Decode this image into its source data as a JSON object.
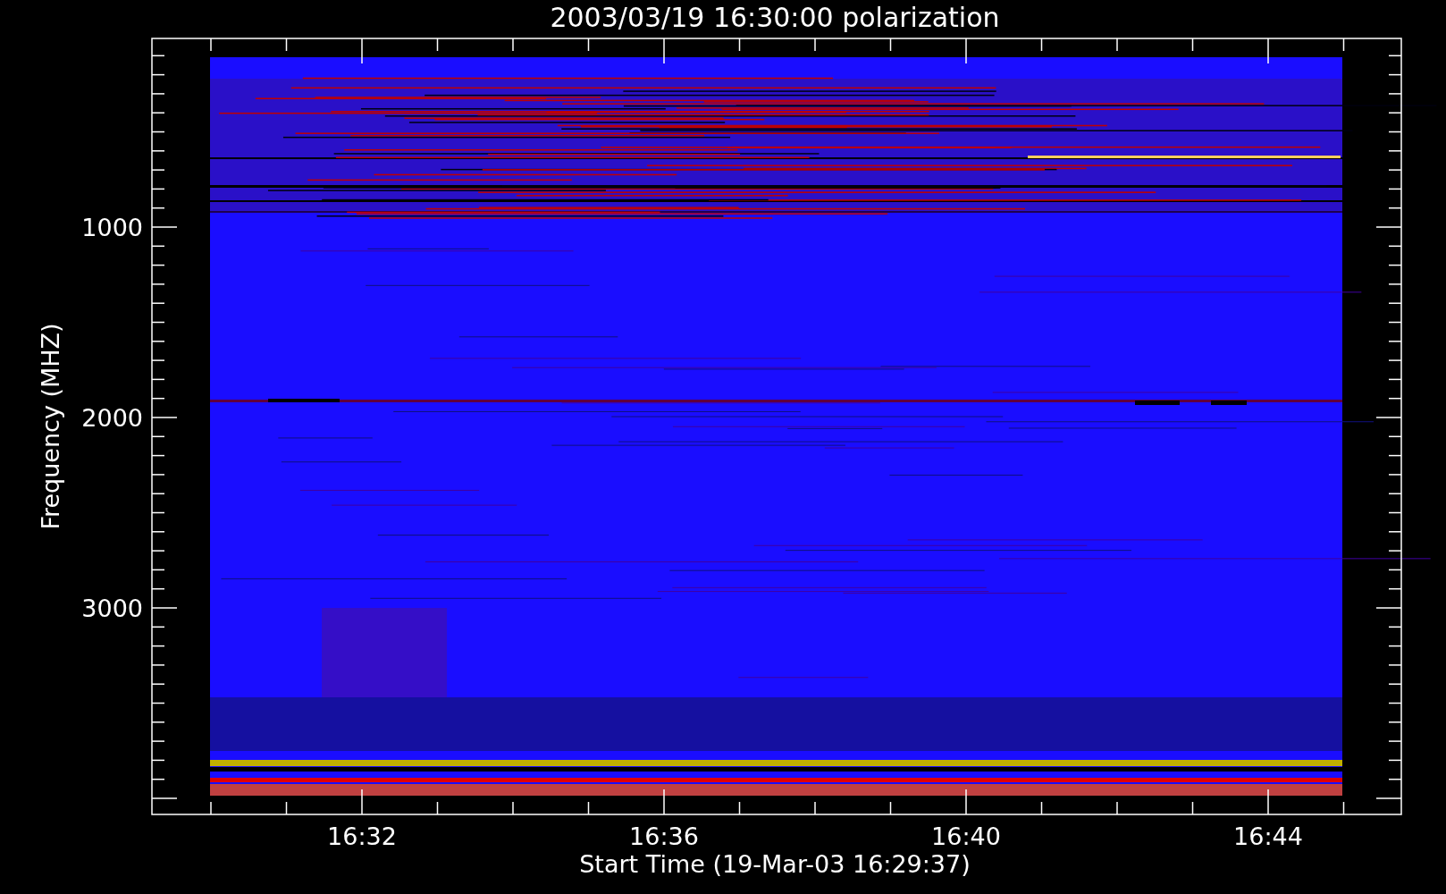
{
  "title": "2003/03/19 16:30:00 polarization",
  "y_axis": {
    "label": "Frequency (MHZ)",
    "ticks": [
      "1000",
      "2000",
      "3000"
    ]
  },
  "x_axis": {
    "label": "Start Time (19-Mar-03 16:29:37)",
    "ticks": [
      "16:32",
      "16:36",
      "16:40",
      "16:44"
    ]
  }
}
